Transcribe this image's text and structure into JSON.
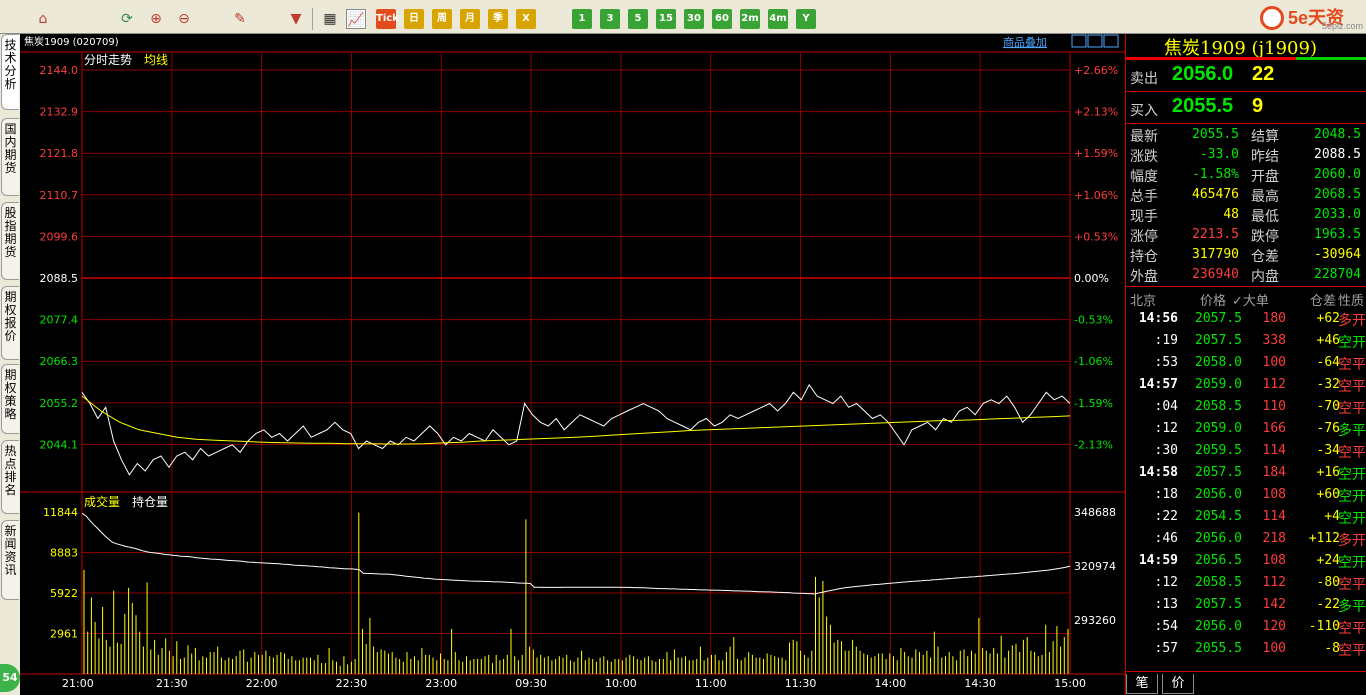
{
  "toolbar": {
    "buttons": [
      {
        "label": "Tick",
        "color": "#e34a1c"
      },
      {
        "label": "日",
        "color": "#d8a400"
      },
      {
        "label": "周",
        "color": "#d8a400"
      },
      {
        "label": "月",
        "color": "#d8a400"
      },
      {
        "label": "季",
        "color": "#d8a400"
      },
      {
        "label": "X",
        "color": "#d8a400"
      },
      {
        "label": "1",
        "color": "#3aa336"
      },
      {
        "label": "3",
        "color": "#3aa336"
      },
      {
        "label": "5",
        "color": "#3aa336"
      },
      {
        "label": "15",
        "color": "#3aa336"
      },
      {
        "label": "30",
        "color": "#3aa336"
      },
      {
        "label": "60",
        "color": "#3aa336"
      },
      {
        "label": "2m",
        "color": "#3aa336"
      },
      {
        "label": "4m",
        "color": "#3aa336"
      },
      {
        "label": "Y",
        "color": "#3aa336"
      }
    ],
    "brand": {
      "main": "5e天资",
      "sub": "5eplz.com"
    }
  },
  "left_rail": {
    "tabs": [
      "技术分析",
      "国内期货",
      "股指期货",
      "期权报价",
      "期权策略",
      "热点排名",
      "新闻资讯"
    ],
    "badge": "54"
  },
  "chart": {
    "title": "焦炭1909 (020709)",
    "overlay_link": "商品叠加",
    "main_legend": {
      "line1": "分时走势",
      "line2": "均线"
    },
    "vol_legend": {
      "line1": "成交量",
      "line2": "持仓量"
    }
  },
  "chart_data": [
    {
      "type": "line",
      "title": "分时走势",
      "series": [
        {
          "name": "分时走势",
          "color": "#ffffff"
        },
        {
          "name": "均线",
          "color": "#ffff00"
        }
      ],
      "x_ticks": [
        "21:00",
        "21:30",
        "22:00",
        "22:30",
        "23:00",
        "09:30",
        "10:00",
        "11:00",
        "11:30",
        "14:00",
        "14:30",
        "15:00"
      ],
      "y_ticks": [
        "2144.0",
        "2132.9",
        "2121.8",
        "2110.7",
        "2099.6",
        "2088.5",
        "2077.4",
        "2066.3",
        "2055.2",
        "2044.1"
      ],
      "pct_ticks": [
        "+2.66%",
        "+2.13%",
        "+1.59%",
        "+1.06%",
        "+0.53%",
        "0.00%",
        "-0.53%",
        "-1.06%",
        "-1.59%",
        "-2.13%"
      ],
      "ylim": [
        2033.0,
        2144.0
      ],
      "reference_price": 2088.5,
      "price_points": [
        2058,
        2055,
        2051,
        2054,
        2045,
        2040,
        2036,
        2039,
        2037,
        2040,
        2041,
        2038,
        2041,
        2042,
        2040,
        2043,
        2041,
        2042,
        2043,
        2044,
        2042,
        2045,
        2047,
        2048,
        2046,
        2047,
        2045,
        2047,
        2049,
        2046,
        2047,
        2048,
        2050,
        2048,
        2047,
        2043,
        2045,
        2044,
        2043,
        2045,
        2044,
        2046,
        2045,
        2047,
        2049,
        2047,
        2044,
        2046,
        2045,
        2047,
        2046,
        2045,
        2048,
        2046,
        2044,
        2045,
        2055,
        2052,
        2050,
        2049,
        2051,
        2048,
        2050,
        2052,
        2051,
        2050,
        2049,
        2051,
        2052,
        2053,
        2054,
        2055,
        2054,
        2053,
        2051,
        2050,
        2049,
        2048,
        2050,
        2051,
        2049,
        2050,
        2052,
        2051,
        2052,
        2053,
        2054,
        2055,
        2053,
        2055,
        2058,
        2056,
        2060,
        2057,
        2056,
        2055,
        2057,
        2054,
        2055,
        2053,
        2051,
        2052,
        2050,
        2047,
        2044,
        2048,
        2049,
        2050,
        2048,
        2051,
        2050,
        2053,
        2054,
        2052,
        2055,
        2056,
        2055,
        2057,
        2054,
        2050,
        2052,
        2055,
        2058,
        2056,
        2057,
        2055
      ],
      "avg_points": [
        2057,
        2053,
        2050,
        2048,
        2047,
        2046,
        2045.5,
        2045.2,
        2045,
        2044.8,
        2044.6,
        2044.5,
        2044.4,
        2044.4,
        2044.3,
        2044.3,
        2044.2,
        2044.2,
        2044.3,
        2044.5,
        2044.7,
        2045,
        2045.2,
        2045.4,
        2045.6,
        2045.8,
        2046,
        2046.3,
        2046.6,
        2046.9,
        2047.2,
        2047.5,
        2047.8,
        2048,
        2048.2,
        2048.4,
        2048.6,
        2048.8,
        2049,
        2049.2,
        2049.4,
        2049.6,
        2049.8,
        2050,
        2050.2,
        2050.4,
        2050.5,
        2050.7,
        2050.9,
        2051.1,
        2051.3,
        2051.5,
        2051.7
      ],
      "last_price": 2055.5
    },
    {
      "type": "bar",
      "title": "成交量",
      "series": [
        {
          "name": "成交量",
          "color": "#ffff00"
        },
        {
          "name": "持仓量",
          "color": "#ffffff"
        }
      ],
      "y_ticks_left": [
        "11844",
        "8883",
        "5922",
        "2961"
      ],
      "y_ticks_right": [
        "348688",
        "320974",
        "293260"
      ],
      "volume_ylim": [
        0,
        11844
      ],
      "open_interest_ylim": [
        265546,
        348688
      ],
      "volumes": [
        7600,
        3100,
        5600,
        3800,
        2600,
        4900,
        2500,
        2000,
        6100,
        2300,
        2200,
        4400,
        6300,
        5200,
        4300,
        3100,
        2000,
        6700,
        1800,
        2500,
        1400,
        1900,
        2600,
        1700,
        1300,
        2400,
        1100,
        1200,
        2100,
        1500,
        1900,
        1000,
        1300,
        1200,
        1600,
        1600,
        2000,
        1200,
        1000,
        1200,
        1100,
        1300,
        1700,
        1800,
        900,
        1200,
        1600,
        1400,
        1400,
        1700,
        1300,
        1200,
        1400,
        1600,
        1500,
        1100,
        1300,
        1000,
        1000,
        1200,
        1200,
        1200,
        1000,
        1400,
        800,
        800,
        1900,
        1000,
        900,
        600,
        1300,
        700,
        900,
        1100,
        11800,
        3300,
        2200,
        4100,
        2000,
        1600,
        1800,
        1700,
        1500,
        1600,
        1200,
        1100,
        900,
        1600,
        1100,
        1300,
        1000,
        1900,
        1400,
        1400,
        1200,
        1000,
        1500,
        1100,
        1000,
        3300,
        1600,
        1000,
        900,
        1300,
        1000,
        1100,
        1100,
        1100,
        1300,
        1400,
        800,
        1400,
        1000,
        1100,
        1400,
        3300,
        1300,
        1000,
        1400,
        11300,
        2000,
        1800,
        1200,
        1400,
        1200,
        1300,
        1000,
        1100,
        1300,
        1200,
        1400,
        1000,
        900,
        1200,
        1700,
        1000,
        1200,
        1100,
        900,
        1200,
        1300,
        1000,
        900,
        1100,
        1100,
        1000,
        1200,
        1400,
        1300,
        1100,
        1000,
        1200,
        1300,
        1000,
        900,
        1100,
        1100,
        1600,
        1000,
        1800,
        1200,
        1200,
        1300,
        1000,
        1000,
        1100,
        2000,
        1000,
        1200,
        1400,
        1400,
        1000,
        1000,
        1600,
        2000,
        2700,
        1100,
        1000,
        1200,
        1600,
        1400,
        1200,
        1200,
        1100,
        1500,
        1400,
        1300,
        1200,
        1200,
        1000,
        2300,
        2500,
        2400,
        1700,
        1400,
        1200,
        1700,
        7100,
        5600,
        6800,
        4200,
        3600,
        2300,
        2500,
        2400,
        1700,
        1700,
        2500,
        2000,
        1700,
        1500,
        1400,
        1200,
        1300,
        1500,
        1500,
        1100,
        1500,
        1300,
        1000,
        1900,
        1600,
        1300,
        1200,
        1800,
        1600,
        1400,
        1700,
        1200,
        3100,
        2000,
        1200,
        1300,
        1600,
        1300,
        1000,
        1700,
        1800,
        1300,
        1700,
        1500,
        4100,
        1900,
        1700,
        1500,
        1900,
        1500,
        2800,
        1200,
        1700,
        2100,
        2200,
        1600,
        2500,
        2700,
        1700,
        1600,
        1300,
        1400,
        3600,
        1600,
        2400,
        3500,
        2000,
        2700,
        3300
      ],
      "open_interest": [
        348000,
        346800,
        344500,
        342400,
        340500,
        338400,
        336500,
        334800,
        333200,
        332400,
        331900,
        331300,
        330900,
        330400,
        330000,
        329400,
        328800,
        328300,
        327900,
        327700,
        327500,
        327200,
        326900,
        326700,
        326400,
        326300,
        326000,
        325900,
        325800,
        325600,
        325200,
        325100,
        324900,
        324700,
        324500,
        324400,
        324300,
        324100,
        323900,
        323800,
        323700,
        323600,
        323400,
        323200,
        323000,
        322900,
        322700,
        322600,
        322500,
        322400,
        322300,
        322200,
        322100,
        321900,
        321800,
        321600,
        321400,
        321300,
        321200,
        321100,
        320900,
        320800,
        320600,
        320500,
        320300,
        320100,
        320000,
        319900,
        319700,
        319600,
        319500,
        319500,
        319300,
        319100,
        317300,
        317200,
        317100,
        317000,
        316900,
        316800,
        316800,
        316700,
        316500,
        316300,
        316100,
        315800,
        315600,
        315400,
        315200,
        315000,
        314700,
        314600,
        314400,
        314200,
        314100,
        314000,
        313900,
        313800,
        313700,
        313600,
        313500,
        313400,
        313300,
        313200,
        313100,
        313100,
        313000,
        313000,
        312900,
        312800,
        312800,
        312700,
        312600,
        312500,
        312400,
        312200,
        312200,
        312100,
        312000,
        310100,
        310100,
        310000,
        310000,
        310000,
        310000,
        310000,
        310000,
        310100,
        310100,
        310100,
        310100,
        310100,
        310100,
        310100,
        310100,
        310100,
        310100,
        310100,
        310100,
        310100,
        310100,
        310100,
        310000,
        310000,
        310000,
        309900,
        309900,
        309800,
        309800,
        309700,
        309600,
        309500,
        309400,
        309400,
        309300,
        309200,
        309200,
        309100,
        309000,
        309000,
        308900,
        308900,
        308800,
        308700,
        308700,
        308600,
        308600,
        308500,
        308500,
        308400,
        308400,
        308300,
        308200,
        308200,
        308100,
        308100,
        308000,
        307900,
        307800,
        307800,
        307700,
        307700,
        307600,
        307500,
        307400,
        307300,
        307300,
        307100,
        307000,
        307000,
        306900,
        306800,
        306700,
        306600,
        307200,
        307600,
        308000,
        308400,
        308800,
        309200,
        309600,
        309900,
        310100,
        310300,
        310500,
        310700,
        310900,
        311100,
        311300,
        311500,
        311600,
        311800,
        312000,
        312200,
        312300,
        312500,
        312700,
        312800,
        313000,
        313100,
        313300,
        313400,
        313600,
        313700,
        313900,
        314000,
        314200,
        314300,
        314500,
        314600,
        314800,
        314900,
        315100,
        315200,
        315400,
        315500,
        315700,
        315800,
        316000,
        316100,
        316300,
        316400,
        316600,
        316700,
        316900,
        317000,
        317200,
        317400,
        317600,
        317800,
        318000,
        318200,
        318400,
        318600,
        318800,
        319100,
        319400,
        319700,
        320000,
        320400,
        320800
      ]
    }
  ],
  "quote": {
    "title": "焦炭1909 (j1909)",
    "sell": {
      "label": "卖出",
      "price": "2056.0",
      "vol": "22"
    },
    "buy": {
      "label": "买入",
      "price": "2055.5",
      "vol": "9"
    },
    "stats": [
      {
        "l1": "最新",
        "v1": "2055.5",
        "c1": "#00e600",
        "l2": "结算",
        "v2": "2048.5",
        "c2": "#00e600"
      },
      {
        "l1": "涨跌",
        "v1": "-33.0",
        "c1": "#00e600",
        "l2": "昨结",
        "v2": "2088.5",
        "c2": "#ffffff"
      },
      {
        "l1": "幅度",
        "v1": "-1.58%",
        "c1": "#00e600",
        "l2": "开盘",
        "v2": "2060.0",
        "c2": "#00e600"
      },
      {
        "l1": "总手",
        "v1": "465476",
        "c1": "#ffff00",
        "l2": "最高",
        "v2": "2068.5",
        "c2": "#00e600"
      },
      {
        "l1": "现手",
        "v1": "48",
        "c1": "#ffff00",
        "l2": "最低",
        "v2": "2033.0",
        "c2": "#00e600"
      },
      {
        "l1": "涨停",
        "v1": "2213.5",
        "c1": "#ff3c3c",
        "l2": "跌停",
        "v2": "1963.5",
        "c2": "#00e600"
      },
      {
        "l1": "持仓",
        "v1": "317790",
        "c1": "#ffff00",
        "l2": "仓差",
        "v2": "-30964",
        "c2": "#ffff00"
      },
      {
        "l1": "外盘",
        "v1": "236940",
        "c1": "#ff3c3c",
        "l2": "内盘",
        "v2": "228704",
        "c2": "#00e600"
      }
    ],
    "ticks_header": {
      "time": "北京",
      "price": "价格",
      "vol": "✓大单",
      "oi": "仓差",
      "kind": "性质"
    },
    "ticks": [
      {
        "time": "14:56",
        "price": "2057.5",
        "vol": "180",
        "oi": "+62",
        "kind": "多开",
        "kind_color": "#ff3c3c",
        "bold": true
      },
      {
        "time": ":19",
        "price": "2057.5",
        "vol": "338",
        "oi": "+46",
        "kind": "空开",
        "kind_color": "#00e600",
        "bold": false
      },
      {
        "time": ":53",
        "price": "2058.0",
        "vol": "100",
        "oi": "-64",
        "kind": "空平",
        "kind_color": "#ff3c3c",
        "bold": false
      },
      {
        "time": "14:57",
        "price": "2059.0",
        "vol": "112",
        "oi": "-32",
        "kind": "空平",
        "kind_color": "#ff3c3c",
        "bold": true
      },
      {
        "time": ":04",
        "price": "2058.5",
        "vol": "110",
        "oi": "-70",
        "kind": "空平",
        "kind_color": "#ff3c3c",
        "bold": false
      },
      {
        "time": ":12",
        "price": "2059.0",
        "vol": "166",
        "oi": "-76",
        "kind": "多平",
        "kind_color": "#00e600",
        "bold": false
      },
      {
        "time": ":30",
        "price": "2059.5",
        "vol": "114",
        "oi": "-34",
        "kind": "空平",
        "kind_color": "#ff3c3c",
        "bold": false
      },
      {
        "time": "14:58",
        "price": "2057.5",
        "vol": "184",
        "oi": "+16",
        "kind": "空开",
        "kind_color": "#00e600",
        "bold": true
      },
      {
        "time": ":18",
        "price": "2056.0",
        "vol": "108",
        "oi": "+60",
        "kind": "空开",
        "kind_color": "#00e600",
        "bold": false
      },
      {
        "time": ":22",
        "price": "2054.5",
        "vol": "114",
        "oi": "+4",
        "kind": "空开",
        "kind_color": "#00e600",
        "bold": false
      },
      {
        "time": ":46",
        "price": "2056.0",
        "vol": "218",
        "oi": "+112",
        "kind": "多开",
        "kind_color": "#ff3c3c",
        "bold": false
      },
      {
        "time": "14:59",
        "price": "2056.5",
        "vol": "108",
        "oi": "+24",
        "kind": "空开",
        "kind_color": "#00e600",
        "bold": true
      },
      {
        "time": ":12",
        "price": "2058.5",
        "vol": "112",
        "oi": "-80",
        "kind": "空平",
        "kind_color": "#ff3c3c",
        "bold": false
      },
      {
        "time": ":13",
        "price": "2057.5",
        "vol": "142",
        "oi": "-22",
        "kind": "多平",
        "kind_color": "#00e600",
        "bold": false
      },
      {
        "time": ":54",
        "price": "2056.0",
        "vol": "120",
        "oi": "-110",
        "kind": "空平",
        "kind_color": "#ff3c3c",
        "bold": false
      },
      {
        "time": ":57",
        "price": "2055.5",
        "vol": "100",
        "oi": "-8",
        "kind": "空平",
        "kind_color": "#ff3c3c",
        "bold": false
      }
    ],
    "bottom_tabs": [
      "笔",
      "价"
    ]
  }
}
